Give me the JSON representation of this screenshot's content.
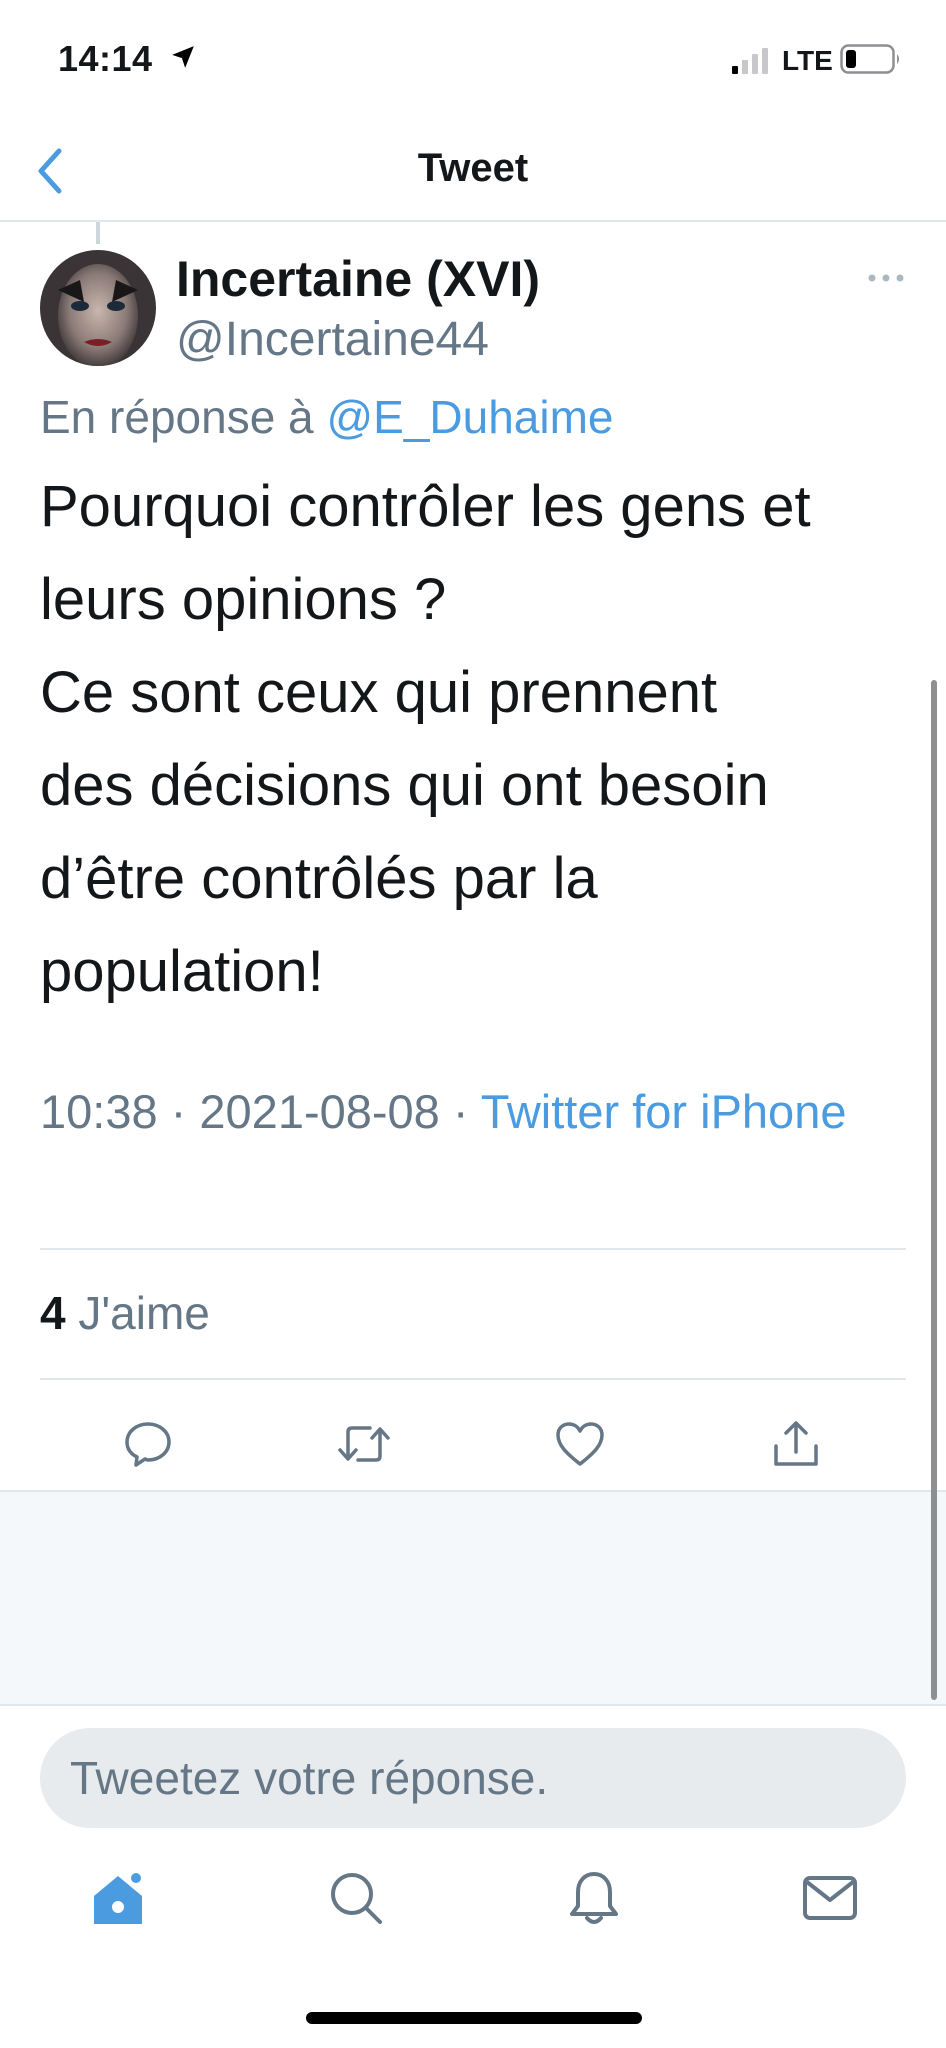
{
  "status_bar": {
    "time": "14:14",
    "network": "LTE"
  },
  "nav": {
    "title": "Tweet"
  },
  "tweet": {
    "display_name": "Incertaine (XVI)",
    "handle": "@Incertaine44",
    "reply_prefix": "En réponse à",
    "reply_mention": "@E_Duhaime",
    "text_lines": [
      "Pourquoi contrôler les gens et",
      "leurs opinions ?",
      "Ce sont ceux qui prennent",
      "des décisions qui ont besoin",
      "d’être contrôlés par la",
      "population!"
    ],
    "time": "10:38",
    "date": "2021-08-08",
    "separator": " · ",
    "source": "Twitter for iPhone",
    "likes_count": "4",
    "likes_label": "J'aime"
  },
  "reply": {
    "placeholder": "Tweetez votre réponse."
  },
  "icons": {
    "back": "chevron-left-icon",
    "more": "ellipsis-icon",
    "reply": "comment-icon",
    "retweet": "retweet-icon",
    "like": "heart-icon",
    "share": "share-icon",
    "home": "home-icon",
    "search": "search-icon",
    "notifications": "bell-icon",
    "messages": "mail-icon"
  },
  "colors": {
    "accent": "#4a9be0",
    "secondary_text": "#657786",
    "primary_text": "#14171a",
    "divider": "#e1e8ed"
  }
}
